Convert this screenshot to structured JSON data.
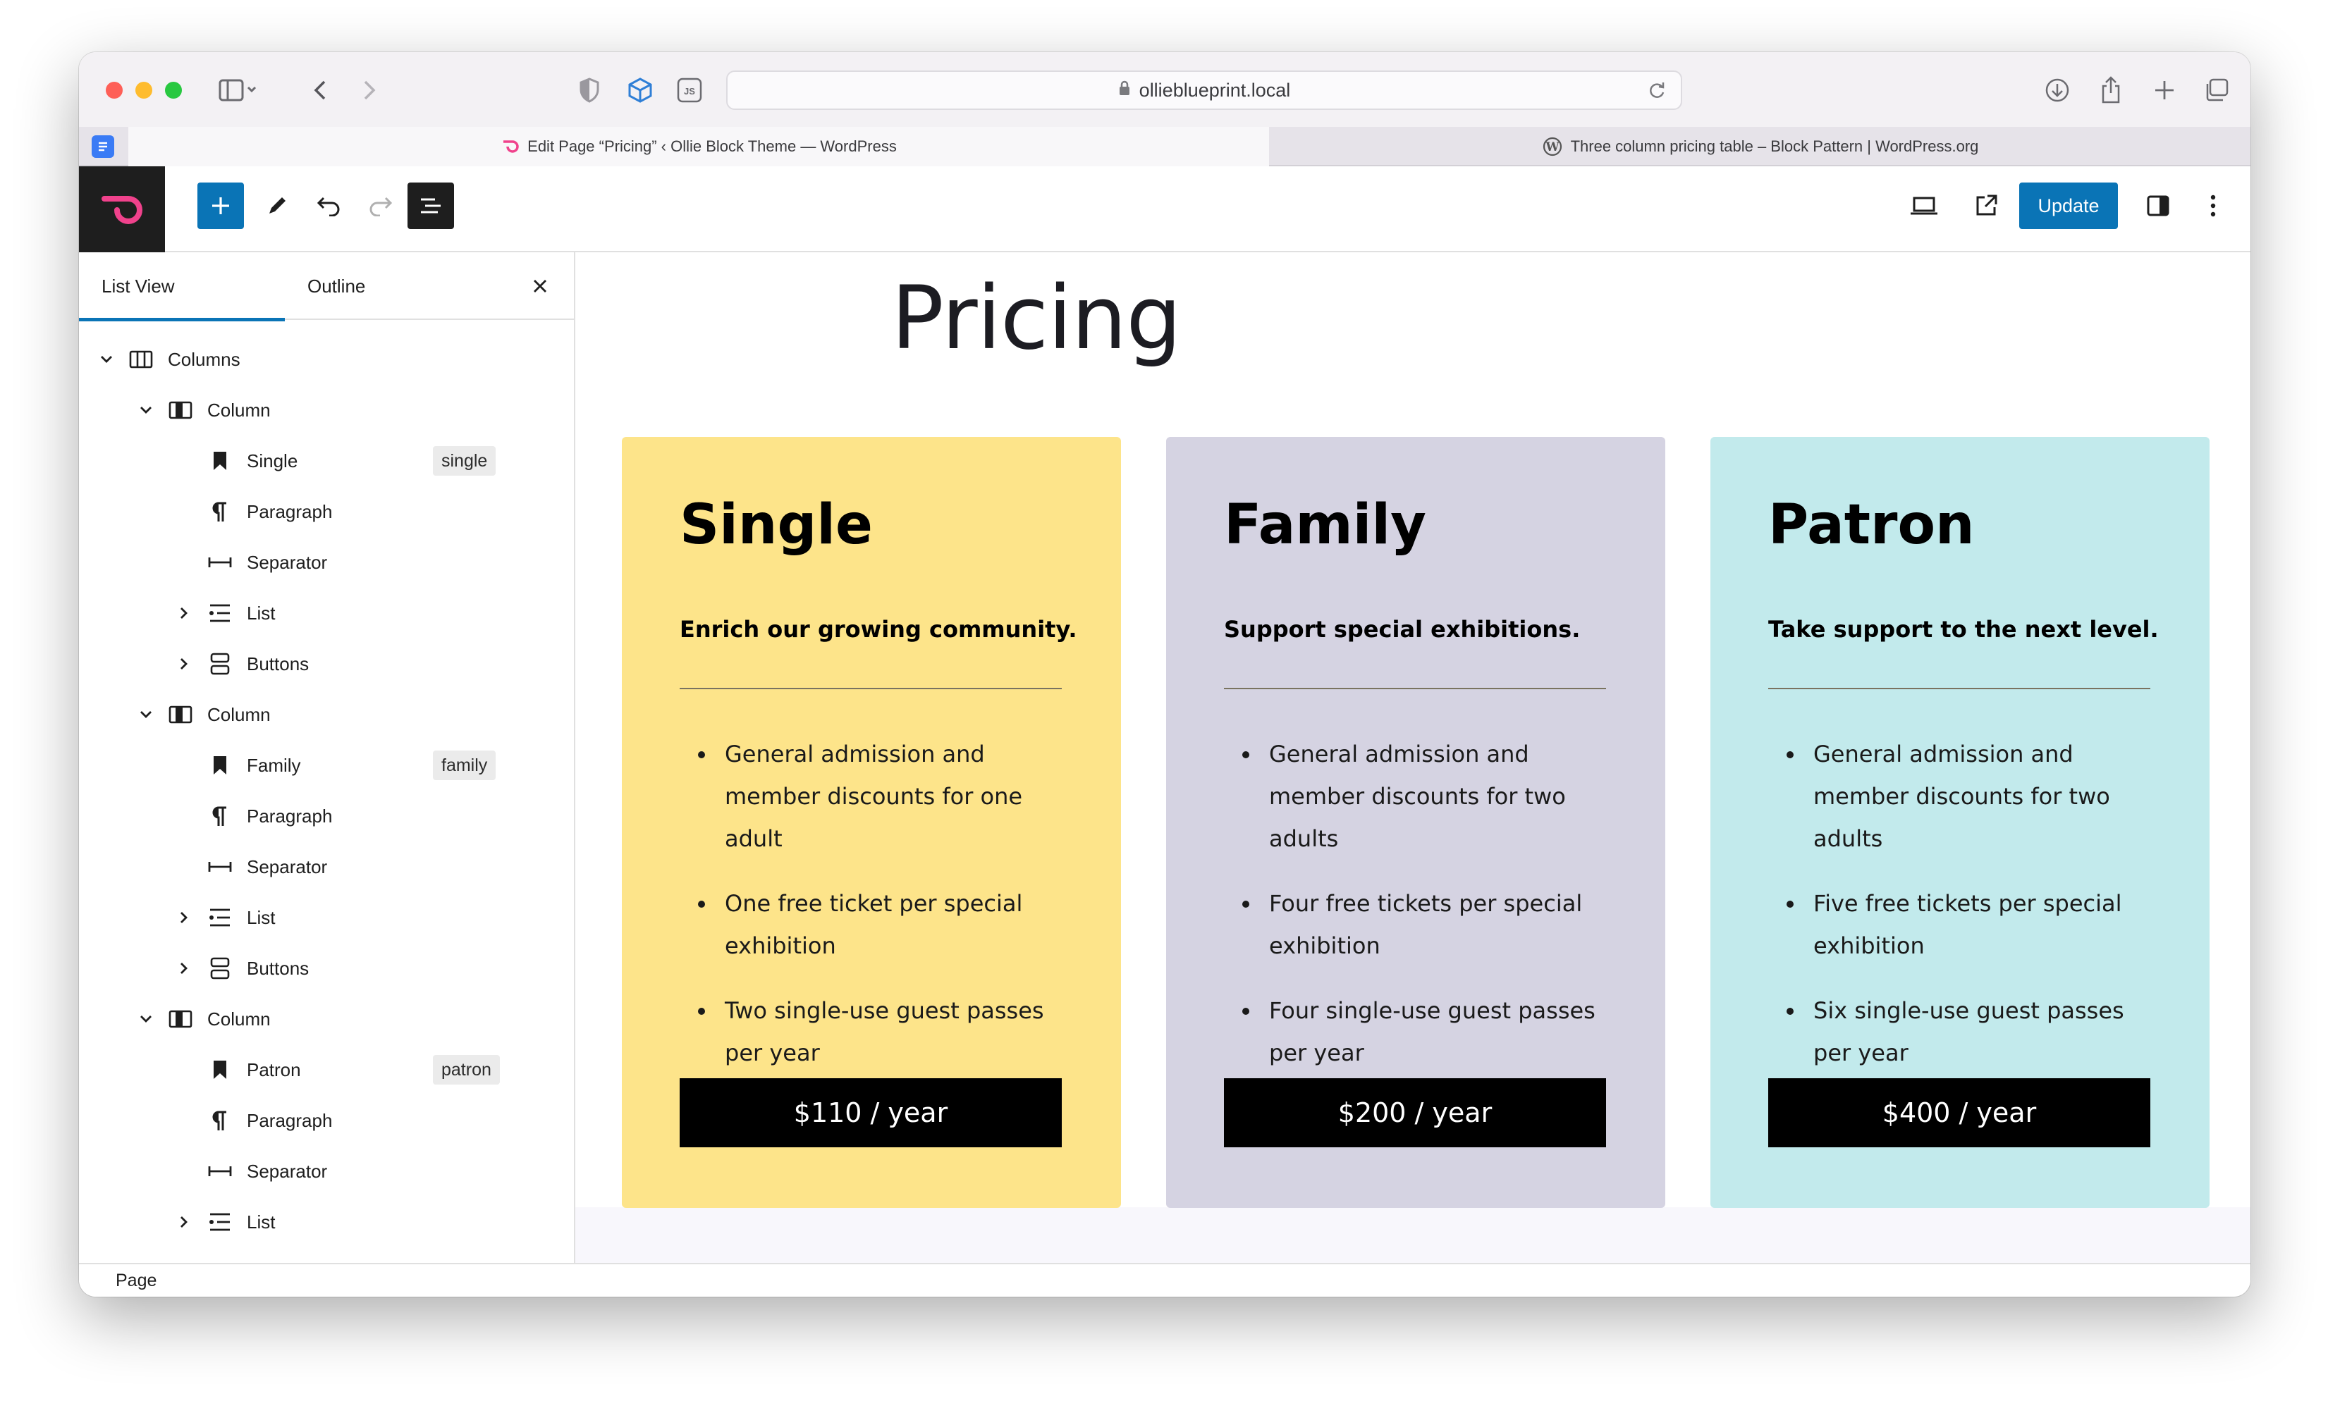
{
  "browser": {
    "url": "ollieblueprint.local",
    "tabs": [
      {
        "label": "Edit Page “Pricing” ‹ Ollie Block Theme — WordPress"
      },
      {
        "label": "Three column pricing table – Block Pattern | WordPress.org"
      }
    ]
  },
  "editor": {
    "update_label": "Update"
  },
  "panel": {
    "tab_list_view": "List View",
    "tab_outline": "Outline"
  },
  "tree": [
    {
      "label": "Columns",
      "badge": ""
    },
    {
      "label": "Column",
      "badge": ""
    },
    {
      "label": "Single",
      "badge": "single"
    },
    {
      "label": "Paragraph",
      "badge": ""
    },
    {
      "label": "Separator",
      "badge": ""
    },
    {
      "label": "List",
      "badge": ""
    },
    {
      "label": "Buttons",
      "badge": ""
    },
    {
      "label": "Column",
      "badge": ""
    },
    {
      "label": "Family",
      "badge": "family"
    },
    {
      "label": "Paragraph",
      "badge": ""
    },
    {
      "label": "Separator",
      "badge": ""
    },
    {
      "label": "List",
      "badge": ""
    },
    {
      "label": "Buttons",
      "badge": ""
    },
    {
      "label": "Column",
      "badge": ""
    },
    {
      "label": "Patron",
      "badge": "patron"
    },
    {
      "label": "Paragraph",
      "badge": ""
    },
    {
      "label": "Separator",
      "badge": ""
    },
    {
      "label": "List",
      "badge": ""
    }
  ],
  "footer": {
    "breadcrumb": "Page"
  },
  "page": {
    "title": "Pricing",
    "cards": [
      {
        "title": "Single",
        "subtitle": "Enrich our growing community.",
        "items": [
          "General admission and member discounts for one adult",
          "One free ticket per special exhibition",
          "Two single-use guest passes per year"
        ],
        "price": "$110 / year",
        "bg": "#fde48a"
      },
      {
        "title": "Family",
        "subtitle": "Support special exhibitions.",
        "items": [
          "General admission and member discounts for two adults",
          "Four free tickets per special exhibition",
          "Four single-use guest passes per year"
        ],
        "price": "$200 / year",
        "bg": "#d5d3e2"
      },
      {
        "title": "Patron",
        "subtitle": "Take support to the next level.",
        "items": [
          "General admission and member discounts for two adults",
          "Five free tickets per special exhibition",
          "Six single-use guest passes per year"
        ],
        "price": "$400 / year",
        "bg": "#c2eaec"
      }
    ]
  },
  "colors": {
    "accent": "#0a74b6",
    "logo_pink": "#f0428c"
  }
}
